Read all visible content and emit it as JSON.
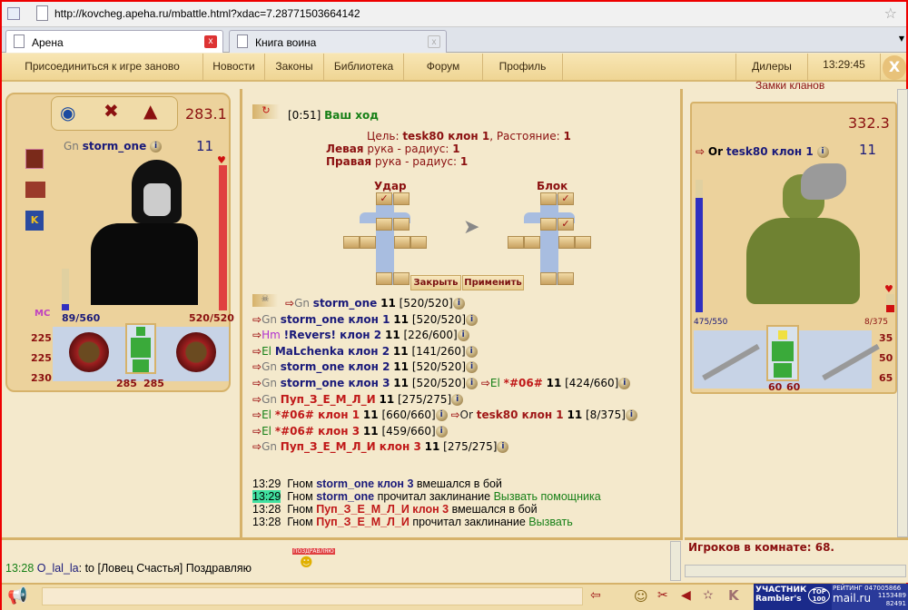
{
  "browser": {
    "url": "http://kovcheg.apeha.ru/mbattle.html?xdac=7.28771503664142",
    "tabs": [
      {
        "label": "Арена",
        "active": true
      },
      {
        "label": "Книга воина",
        "active": false
      }
    ]
  },
  "nav": {
    "items": [
      "Присоединиться к игре заново",
      "Новости",
      "Законы",
      "Библиотека",
      "Форум",
      "Профиль",
      "Дилеры"
    ],
    "clock": "13:29:45",
    "clan_locks": "Замки кланов",
    "close": "X"
  },
  "player": {
    "race": "Gn",
    "name": "storm_one",
    "level": "11",
    "score": "283.1",
    "mana": "89/560",
    "hp": "520/520",
    "stats": [
      "225",
      "225",
      "230"
    ],
    "armor": [
      "285",
      "285"
    ],
    "mana_frac": 0.16,
    "hp_frac": 1.0,
    "badge": "MC"
  },
  "enemy": {
    "race": "Or",
    "name": "tesk80 клон 1",
    "level": "11",
    "score": "332.3",
    "mana": "475/550",
    "hp": "8/375",
    "stats": [
      "35",
      "50",
      "65"
    ],
    "armor": [
      "60",
      "60"
    ],
    "mana_frac": 0.86,
    "hp_frac": 0.02
  },
  "battle": {
    "timer": "[0:51]",
    "turn": "Ваш ход",
    "target_label": "Цель:",
    "target": "tesk80 клон 1",
    "distance_label": ", Растояние:",
    "distance": "1",
    "left_hand": "Левая",
    "right_hand": "Правая",
    "hand_text": "рука - радиус:",
    "radius": "1",
    "strike": "Удар",
    "block": "Блок",
    "close_btn": "Закрыть",
    "apply_btn": "Применить"
  },
  "fighters": [
    [
      {
        "race": "Gn",
        "race_color": "#777",
        "name": "storm_one",
        "name_color": "#1a1a7a",
        "level": "11",
        "hp": "[520/520]"
      }
    ],
    [
      {
        "race": "Gn",
        "race_color": "#777",
        "name": "storm_one клон 1",
        "name_color": "#1a1a7a",
        "level": "11",
        "hp": "[520/520]"
      }
    ],
    [
      {
        "race": "Hm",
        "race_color": "#b030d0",
        "name": "!Revers! клон 2",
        "name_color": "#1a1a7a",
        "level": "11",
        "hp": "[226/600]"
      }
    ],
    [
      {
        "race": "El",
        "race_color": "#178017",
        "name": "MaLchenka клон 2",
        "name_color": "#1a1a7a",
        "level": "11",
        "hp": "[141/260]"
      }
    ],
    [
      {
        "race": "Gn",
        "race_color": "#777",
        "name": "storm_one клон 2",
        "name_color": "#1a1a7a",
        "level": "11",
        "hp": "[520/520]"
      }
    ],
    [
      {
        "race": "Gn",
        "race_color": "#777",
        "name": "storm_one клон 3",
        "name_color": "#1a1a7a",
        "level": "11",
        "hp": "[520/520]"
      },
      {
        "race": "El",
        "race_color": "#178017",
        "name": "*#06#",
        "name_color": "#c01818",
        "level": "11",
        "hp": "[424/660]"
      }
    ],
    [
      {
        "race": "Gn",
        "race_color": "#777",
        "name": "Пуп_З_Е_М_Л_И",
        "name_color": "#c01818",
        "level": "11",
        "hp": "[275/275]"
      }
    ],
    [
      {
        "race": "El",
        "race_color": "#178017",
        "name": "*#06# клон 1",
        "name_color": "#c01818",
        "level": "11",
        "hp": "[660/660]"
      },
      {
        "race": "Or",
        "race_color": "#222",
        "name": "tesk80 клон 1",
        "name_color": "#a01818",
        "level": "11",
        "hp": "[8/375]"
      }
    ],
    [
      {
        "race": "El",
        "race_color": "#178017",
        "name": "*#06# клон 3",
        "name_color": "#c01818",
        "level": "11",
        "hp": "[459/660]"
      }
    ],
    [
      {
        "race": "Gn",
        "race_color": "#777",
        "name": "Пуп_З_Е_М_Л_И клон 3",
        "name_color": "#c01818",
        "level": "11",
        "hp": "[275/275]"
      }
    ]
  ],
  "log": [
    {
      "time": "13:29",
      "race": "Гном",
      "name": "storm_one клон 3",
      "name_color": "#1a1a7a",
      "text": "вмешался в бой",
      "spell": ""
    },
    {
      "time": "13:29",
      "highlight": true,
      "race": "Гном",
      "name": "storm_one",
      "name_color": "#1a1a7a",
      "text": "прочитал заклинание",
      "spell": "Вызвать помощника"
    },
    {
      "time": "13:28",
      "race": "Гном",
      "name": "Пуп_З_Е_М_Л_И клон 3",
      "name_color": "#c01818",
      "text": "вмешался в бой",
      "spell": ""
    },
    {
      "time": "13:28",
      "race": "Гном",
      "name": "Пуп_З_Е_М_Л_И",
      "name_color": "#c01818",
      "text": "прочитал заклинание",
      "spell": "Вызвать"
    }
  ],
  "chat": {
    "time": "13:28",
    "user": "O_lal_la",
    "message": ": to [Ловец Счастья] Поздравляю",
    "smiley_caption": "ПОЗДРАВЛЯЮ",
    "players_in_room": "Игроков в комнате: 68.",
    "input": ""
  },
  "counters": {
    "rambler_top": "УЧАСТНИК",
    "rambler": "Rambler's",
    "top": "TOP 100",
    "mail_label": "РЕЙТИНГ",
    "mail": "mail.ru",
    "mail_nums": [
      "047005866",
      "1153489",
      "82491"
    ]
  }
}
